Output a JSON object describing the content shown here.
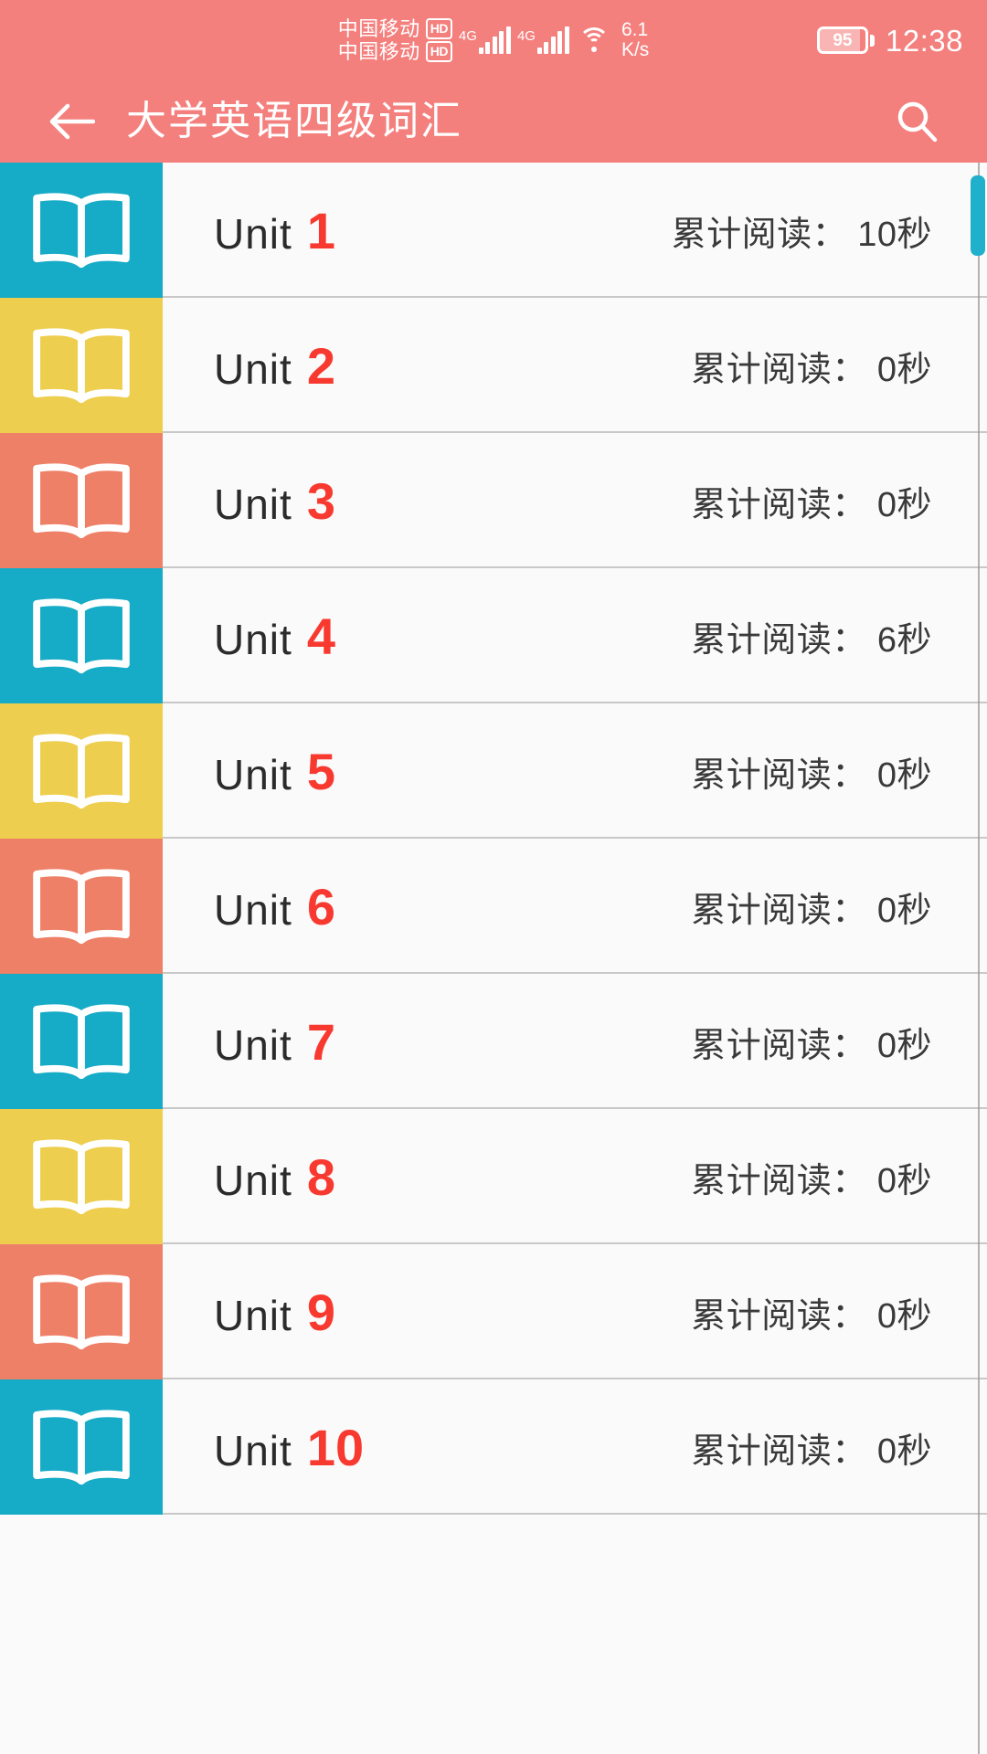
{
  "theme": {
    "header_pink": "#f4807e",
    "accent_red": "#f8392f",
    "tile_cyan": "#16abc6",
    "tile_yellow": "#eece4e",
    "tile_salmon": "#ef8068",
    "scrollbar_cyan": "#20b0cb",
    "list_background": "#fafafa"
  },
  "statusbar": {
    "carrier_line1": "中国移动",
    "carrier_line2": "中国移动",
    "hd_badge_1": "HD",
    "hd_badge_2": "HD",
    "net_type_1": "4G",
    "net_type_2": "4G",
    "speed_value": "6.1",
    "speed_unit": "K/s",
    "battery_percent": "95",
    "time": "12:38",
    "icons": {
      "signal": "signal-bars-icon",
      "wifi": "wifi-icon",
      "battery": "battery-icon"
    }
  },
  "appbar": {
    "back_icon": "back-arrow-icon",
    "title": "大学英语四级词汇",
    "search_icon": "search-icon"
  },
  "list": {
    "unit_word": "Unit",
    "stat_prefix": "累计阅读：",
    "rows": [
      {
        "unit": "1",
        "unit_word": "Unit",
        "stat": "累计阅读： 10秒",
        "tile_color": "#16abc6",
        "icon": "open-book-icon"
      },
      {
        "unit": "2",
        "unit_word": "Unit",
        "stat": "累计阅读： 0秒",
        "tile_color": "#eece4e",
        "icon": "open-book-icon"
      },
      {
        "unit": "3",
        "unit_word": "Unit",
        "stat": "累计阅读： 0秒",
        "tile_color": "#ef8068",
        "icon": "open-book-icon"
      },
      {
        "unit": "4",
        "unit_word": "Unit",
        "stat": "累计阅读： 6秒",
        "tile_color": "#16abc6",
        "icon": "open-book-icon"
      },
      {
        "unit": "5",
        "unit_word": "Unit",
        "stat": "累计阅读： 0秒",
        "tile_color": "#eece4e",
        "icon": "open-book-icon"
      },
      {
        "unit": "6",
        "unit_word": "Unit",
        "stat": "累计阅读： 0秒",
        "tile_color": "#ef8068",
        "icon": "open-book-icon"
      },
      {
        "unit": "7",
        "unit_word": "Unit",
        "stat": "累计阅读： 0秒",
        "tile_color": "#16abc6",
        "icon": "open-book-icon"
      },
      {
        "unit": "8",
        "unit_word": "Unit",
        "stat": "累计阅读： 0秒",
        "tile_color": "#eece4e",
        "icon": "open-book-icon"
      },
      {
        "unit": "9",
        "unit_word": "Unit",
        "stat": "累计阅读： 0秒",
        "tile_color": "#ef8068",
        "icon": "open-book-icon"
      },
      {
        "unit": "10",
        "unit_word": "Unit",
        "stat": "累计阅读： 0秒",
        "tile_color": "#16abc6",
        "icon": "open-book-icon"
      }
    ]
  },
  "scrollbar": {
    "name": "vertical-scrollbar",
    "thumb_color": "#20b0cb"
  }
}
